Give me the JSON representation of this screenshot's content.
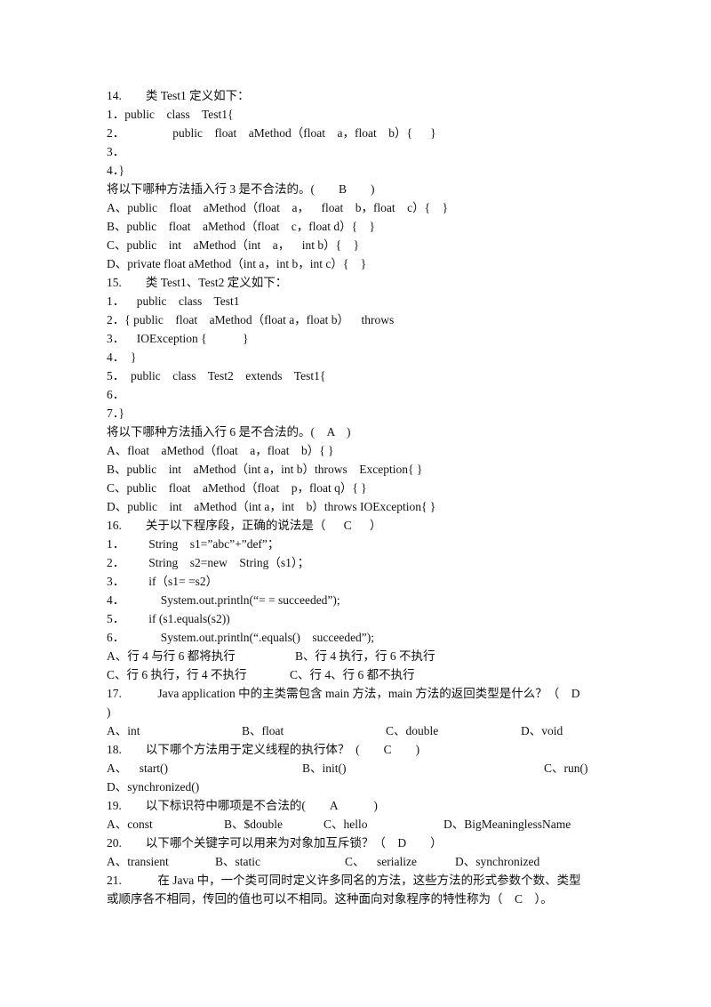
{
  "document": {
    "q14": {
      "title": "14.        类 Test1 定义如下：",
      "code": [
        "1．public    class    Test1{",
        "2．                public    float    aMethod（float    a，float    b）{      }",
        "3．",
        "4．}"
      ],
      "question": "将以下哪种方法插入行 3 是不合法的。(        B        )",
      "options": [
        "A、public    float    aMethod（float    a，    float    b，float    c）{    }",
        "B、public    float    aMethod（float    c，float d）{    }",
        "C、public    int    aMethod（int    a，    int b）{    }",
        "D、private float aMethod（int a，int b，int c）{    }"
      ]
    },
    "q15": {
      "title": "15.        类 Test1、Test2 定义如下：",
      "code": [
        "1．    public    class    Test1",
        "2．{ public    float    aMethod（float a，float b）    throws",
        "3．    IOException {            }",
        "4．  }",
        "5．  public    class    Test2    extends    Test1{",
        "6．",
        "7．}"
      ],
      "question": "将以下哪种方法插入行 6 是不合法的。(    A    )",
      "options": [
        "A、float    aMethod（float    a，float    b）{ }",
        "B、public    int    aMethod（int a，int b）throws    Exception{ }",
        "C、public    float    aMethod（float    p，float q）{ }",
        "D、public    int    aMethod（int a，int    b）throws IOException{ }"
      ]
    },
    "q16": {
      "title": "16.        关于以下程序段，正确的说法是（      C      ）",
      "code": [
        "1．        String    s1=”abc”+”def”；",
        "2．        String    s2=new    String（s1）；",
        "3．        if（s1= =s2）",
        "4．            System.out.println(“= = succeeded”);",
        "5．        if (s1.equals(s2))",
        "6．            System.out.println(“.equals()    succeeded”);"
      ],
      "options_row1": [
        "A、行 4 与行 6 都将执行",
        "B、行 4 执行，行 6 不执行"
      ],
      "options_row2": [
        "C、行 6 执行，行 4 不执行",
        "C、行 4、行 6 都不执行"
      ]
    },
    "q17": {
      "title": "17.            Java application 中的主类需包含 main 方法，main 方法的返回类型是什么？（    D",
      "title_cont": ")",
      "options": [
        "A、int",
        "B、float",
        "C、double",
        "D、void"
      ]
    },
    "q18": {
      "title": "18.        以下哪个方法用于定义线程的执行体？  (        C        )",
      "options": [
        "A、    start()",
        "B、init()",
        "C、run()",
        "D、synchronized()"
      ]
    },
    "q19": {
      "title": "19.        以下标识符中哪项是不合法的(        A            )",
      "options": [
        "A、const",
        "B、$double",
        "C、hello",
        "D、BigMeaninglessName"
      ]
    },
    "q20": {
      "title": "20.        以下哪个关键字可以用来为对象加互斥锁？（    D        ）",
      "options": [
        "A、transient",
        "B、static",
        "C、    serialize",
        "D、synchronized"
      ]
    },
    "q21": {
      "line1": "21.            在 Java 中，一个类可同时定义许多同名的方法，这些方法的形式参数个数、类型",
      "line2": "或顺序各不相同，传回的值也可以不相同。这种面向对象程序的特性称为（    C    ）。"
    }
  }
}
